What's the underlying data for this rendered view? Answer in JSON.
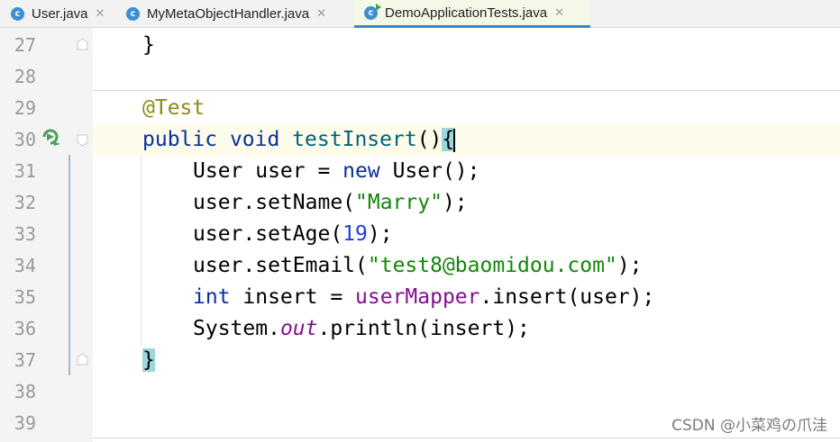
{
  "tabs": [
    {
      "label": "User.java",
      "active": false
    },
    {
      "label": "MyMetaObjectHandler.java",
      "active": false
    },
    {
      "label": "DemoApplicationTests.java",
      "active": true
    }
  ],
  "tab_icon_letter": "c",
  "close_glyph": "✕",
  "line_numbers": [
    "27",
    "28",
    "29",
    "30",
    "31",
    "32",
    "33",
    "34",
    "35",
    "36",
    "37",
    "38",
    "39"
  ],
  "code": {
    "l27": "}",
    "l29": "@Test",
    "l30": {
      "kw1": "public",
      "kw2": "void",
      "name": "testInsert",
      "paren": "()",
      "brace": "{"
    },
    "l31": {
      "a": "User user = ",
      "kw": "new",
      "b": " User();"
    },
    "l32": {
      "a": "user.setName(",
      "str": "\"Marry\"",
      "b": ");"
    },
    "l33": {
      "a": "user.setAge(",
      "num": "19",
      "b": ");"
    },
    "l34": {
      "a": "user.setEmail(",
      "str": "\"test8@baomidou.com\"",
      "b": ");"
    },
    "l35": {
      "kw": "int",
      "a": " insert = ",
      "fld": "userMapper",
      "b": ".insert(user);"
    },
    "l36": {
      "a": "System.",
      "ital": "out",
      "b": ".println(insert);"
    },
    "l37": "}"
  },
  "watermark": "CSDN @小菜鸡の爪洼",
  "colors": {
    "keyword": "#0a2f9e",
    "annotation": "#8f8a1b",
    "string": "#14860a",
    "number": "#1d3fe0",
    "field": "#83108f",
    "accent": "#4083c9"
  }
}
